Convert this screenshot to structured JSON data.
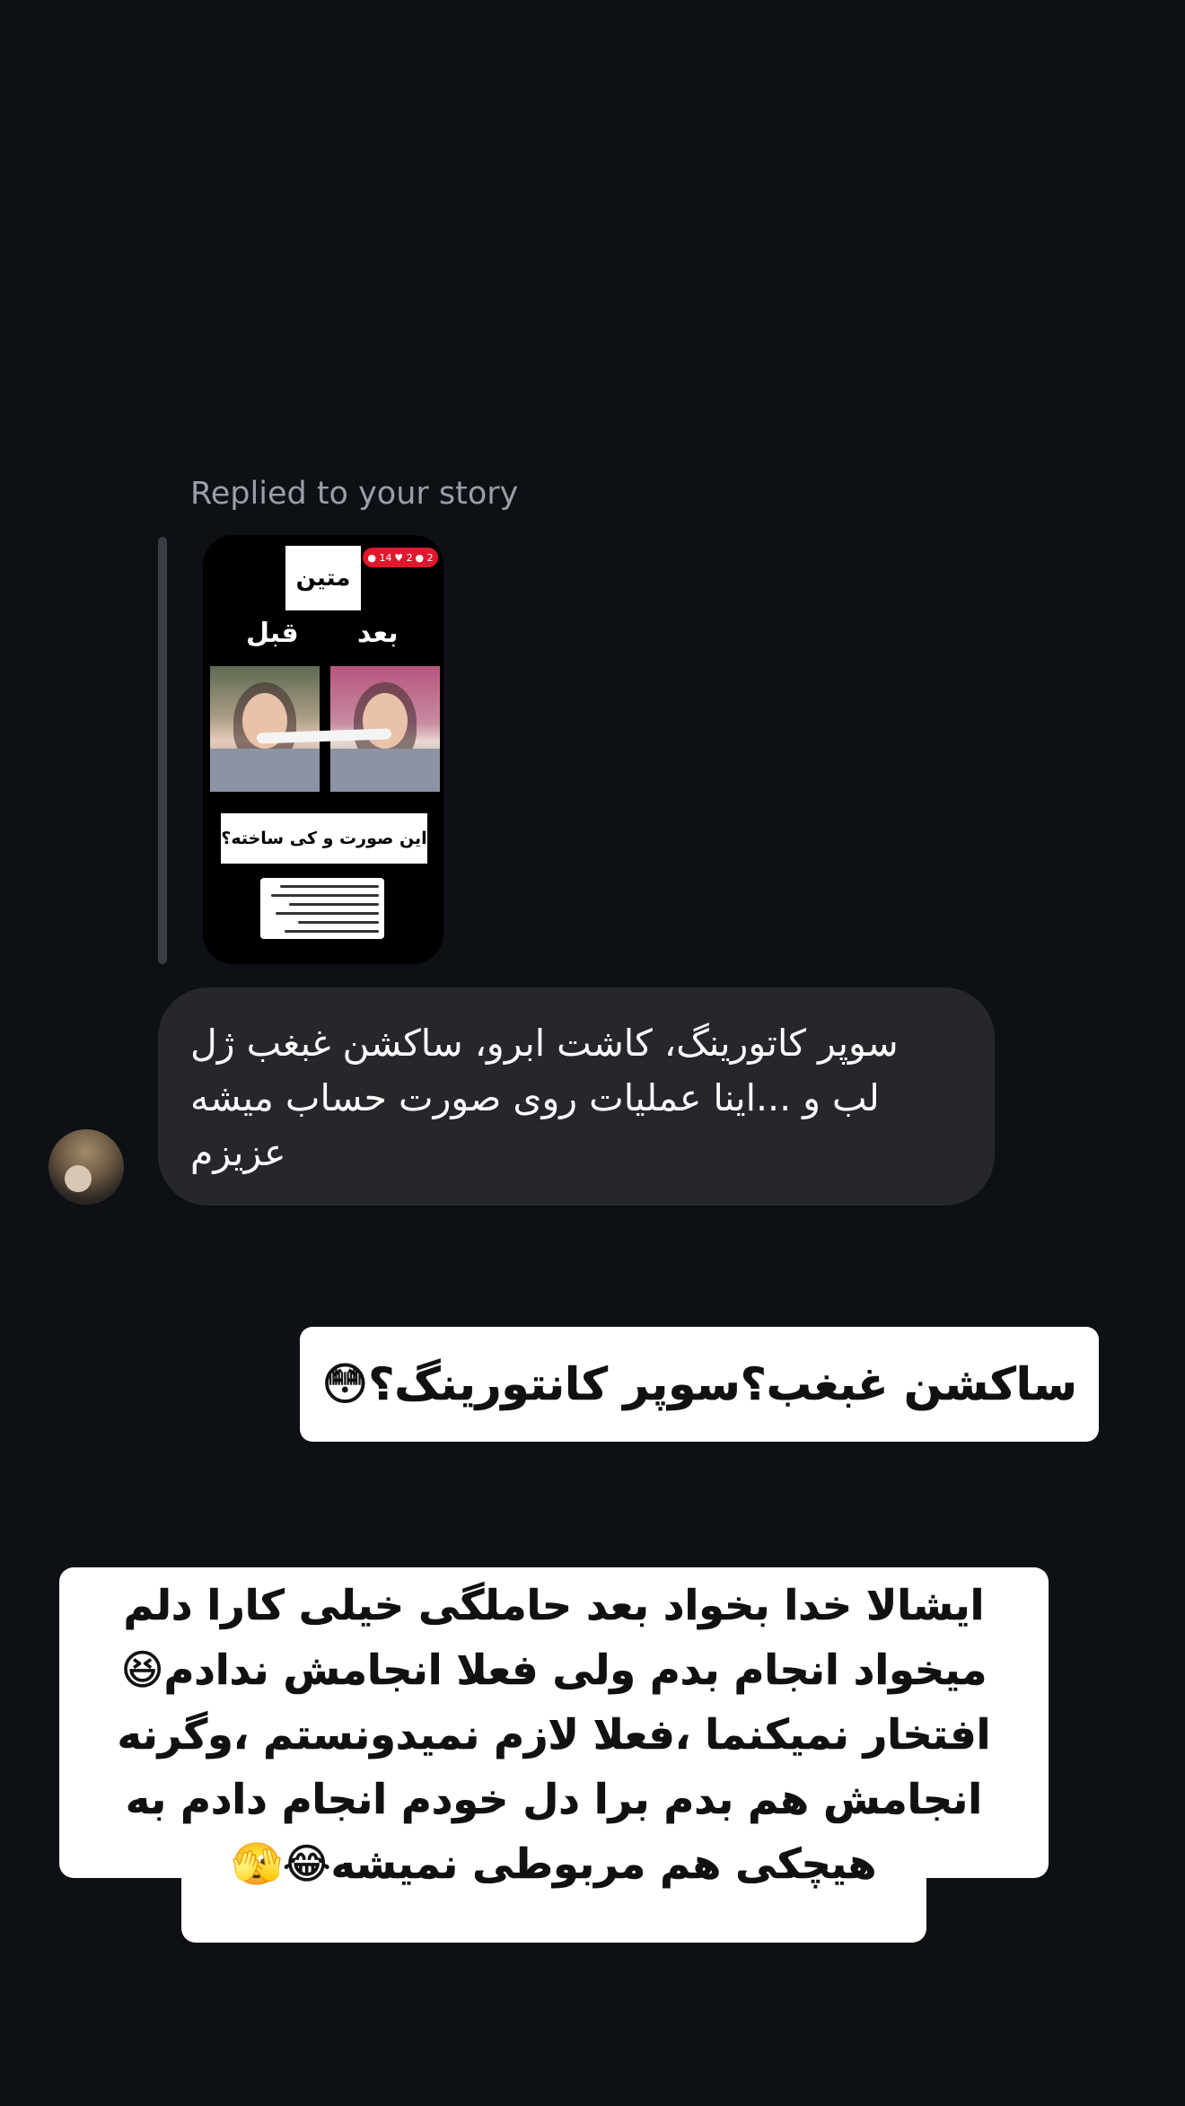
{
  "reply_header": {
    "label": "Replied to your story"
  },
  "story_preview": {
    "title": "متین",
    "label_after": "بعد",
    "label_before": "قبل",
    "question": "این صورت و کی ساخته؟",
    "stats": {
      "comments": "14",
      "likes": "2",
      "viewers": "2"
    }
  },
  "received_message": {
    "text": "سوپر کاتورینگ، کاشت ابرو، ساکشن غبغب ژل لب و ...اینا عملیات روی صورت حساب میشه عزیزم",
    "lines": [
      "سوپر کاتورینگ، کاشت ابرو، ساکشن غبغب ژل",
      "لب و ...اینا عملیات روی صورت حساب میشه",
      "عزیزم"
    ]
  },
  "sticker_1": {
    "text": "ساکشن غبغب؟سوپر کانتورینگ؟😳"
  },
  "sticker_2": {
    "lines": [
      "ایشالا خدا بخواد بعد حاملگی خیلی کارا دلم",
      "میخواد انجام بدم ولی فعلا انجامش ندادم😆",
      "افتخار نمیکنما ،فعلا لازم نمیدونستم ،وگرنه",
      "انجامش هم بدم برا دل خودم انجام دادم به",
      "هیچکی هم مربوطی نمیشه😂🫣"
    ]
  },
  "colors": {
    "background": "#0d1015",
    "received_bubble": "#25272d",
    "muted_text": "#9a9ea6",
    "story_badge": "#e0182d"
  }
}
